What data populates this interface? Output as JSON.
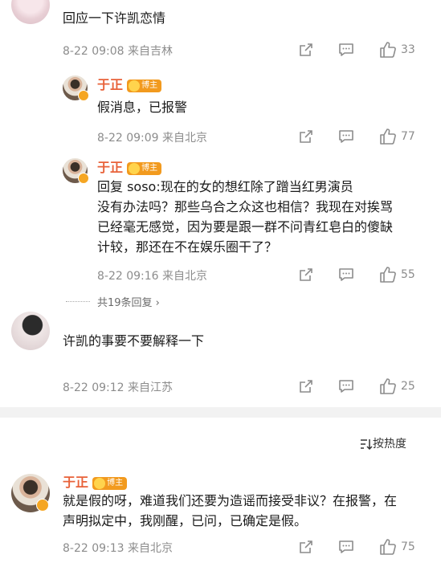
{
  "comment1": {
    "text": "回应一下许凯恋情",
    "meta": "8-22 09:08 来自吉林",
    "likes": "33",
    "replies": [
      {
        "author": "于正",
        "badge": "博主",
        "text": "假消息，已报警",
        "meta": "8-22 09:09 来自北京",
        "likes": "77"
      },
      {
        "author": "于正",
        "badge": "博主",
        "text_lines": [
          "回复          soso:现在的女的想红除了蹭当红男演员",
          "没有办法吗？那些乌合之众这也相信？我现在对挨骂",
          "已经毫无感觉，因为要是跟一群不问青红皂白的傻缺",
          "计较，那还在不在娱乐圈干了？"
        ],
        "meta": "8-22 09:16 来自北京",
        "likes": "55"
      }
    ],
    "more_replies": "共19条回复 ›"
  },
  "comment2": {
    "text": "许凯的事要不要解释一下",
    "meta": "8-22 09:12 来自江苏",
    "likes": "25"
  },
  "sort_label": "按热度",
  "comment3": {
    "author": "于正",
    "badge": "博主",
    "text_lines": [
      "就是假的呀，难道我们还要为造谣而接受非议？在报警，在",
      "声明拟定中，我刚醒，已问，已确定是假。"
    ],
    "meta": "8-22 09:13 来自北京",
    "likes": "75"
  },
  "icons": [
    "share-icon",
    "comment-icon",
    "like-icon",
    "sort-icon",
    "more-replies-chevron-icon"
  ],
  "colors": {
    "author": "#e8623a",
    "badge": "#f29a1e",
    "meta": "#8c8c8c",
    "divider": "#f2f2f2"
  }
}
